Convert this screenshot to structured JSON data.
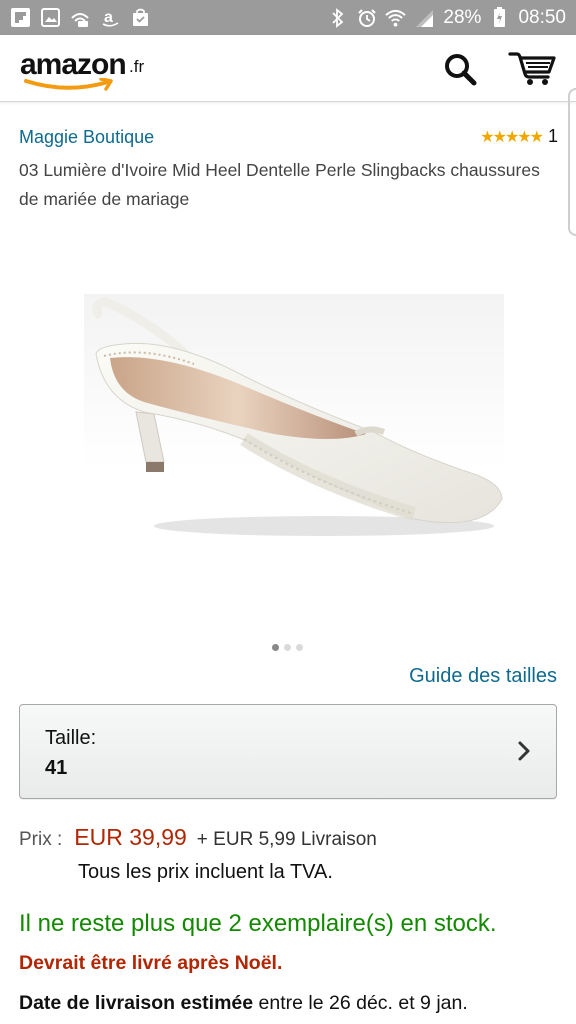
{
  "status_bar": {
    "battery": "28%",
    "time": "08:50"
  },
  "header": {
    "logo_text": "amazon",
    "logo_tld": ".fr"
  },
  "product": {
    "brand": "Maggie Boutique",
    "rating_count": "1",
    "stars": "★★★★★",
    "title": "03 Lumière d'Ivoire Mid Heel Dentelle Perle Slingbacks chaussures de mariée de mariage"
  },
  "size_guide": "Guide des tailles",
  "size": {
    "label": "Taille:",
    "value": "41"
  },
  "price": {
    "label": "Prix :",
    "value": "EUR 39,99",
    "shipping": "+ EUR 5,99 Livraison",
    "tva": "Tous les prix incluent la TVA."
  },
  "stock": "Il ne reste plus que 2 exemplaire(s) en stock.",
  "delivery": {
    "warning": "Devrait être livré après Noël.",
    "estimate_label": "Date de livraison estimée",
    "estimate_value": "entre le 26 déc. et 9 jan."
  },
  "colors": {
    "link": "#0e6a8f",
    "price": "#b12704",
    "stock": "#128a00",
    "star": "#f0a800"
  },
  "icons": {
    "status_left": [
      "flipboard-icon",
      "gallery-icon",
      "wifi-calling-icon",
      "amazon-icon",
      "shopping-bag-icon"
    ],
    "status_right": [
      "bluetooth-icon",
      "alarm-icon",
      "wifi-icon",
      "signal-icon",
      "battery-icon"
    ],
    "header": [
      "search-icon",
      "cart-icon"
    ]
  },
  "carousel": {
    "pages": 3,
    "active_index": 0
  }
}
